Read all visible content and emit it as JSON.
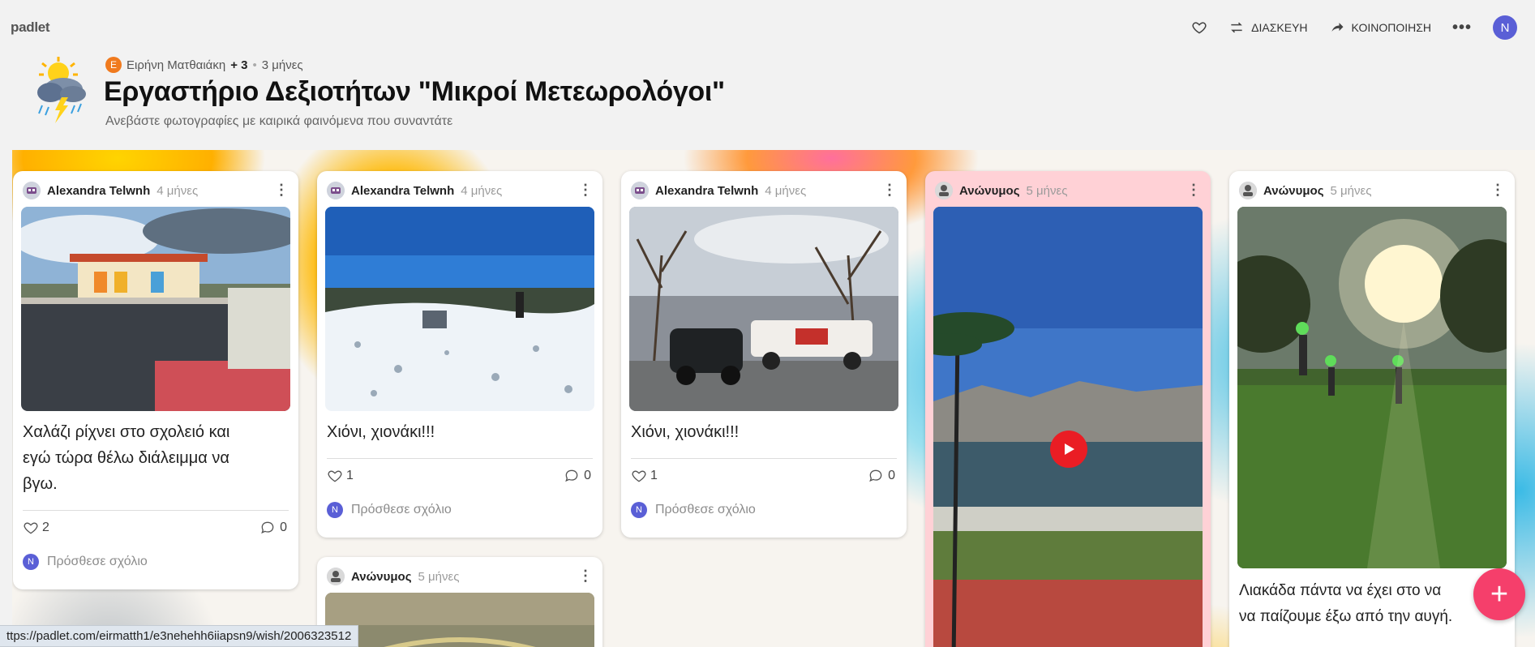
{
  "app": {
    "logo": "padlet"
  },
  "toolbar": {
    "like_icon": "heart-icon",
    "remix_label": "ΔΙΑΣΚΕΥΗ",
    "share_label": "ΚΟΙΝΟΠΟΙΗΣΗ",
    "more_label": "•••",
    "user_initial": "N"
  },
  "header": {
    "owner_initial": "Ε",
    "owner": "Ειρήνη Ματθαιάκη",
    "collaborators": "+ 3",
    "separator": "•",
    "age": "3 μήνες",
    "title": "Εργαστήριο Δεξιοτήτων \"Μικροί Μετεωρολόγοι\"",
    "subtitle": "Ανεβάστε φωτογραφίες με καιρικά φαινόμενα που συναντάτε"
  },
  "posts": [
    {
      "author": "Alexandra Telwnh",
      "time": "4 μήνες",
      "text_lines": [
        "Χαλάζι ρίχνει στο σχολειό και",
        "εγώ τώρα θέλω διάλειμμα να",
        "βγω."
      ],
      "likes": "2",
      "comments": "0",
      "add_comment": "Πρόσθεσε σχόλιο",
      "user_initial": "N"
    },
    {
      "author": "Alexandra Telwnh",
      "time": "4 μήνες",
      "text": "Χιόνι, χιονάκι!!!",
      "likes": "1",
      "comments": "0",
      "add_comment": "Πρόσθεσε σχόλιο",
      "user_initial": "N"
    },
    {
      "author": "Alexandra Telwnh",
      "time": "4 μήνες",
      "text": "Χιόνι, χιονάκι!!!",
      "likes": "1",
      "comments": "0",
      "add_comment": "Πρόσθεσε σχόλιο",
      "user_initial": "N"
    },
    {
      "author": "Ανώνυμος",
      "time": "5 μήνες"
    },
    {
      "author": "Ανώνυμος",
      "time": "5 μήνες",
      "text_lines": [
        "Λιακάδα πάντα να έχει στο να",
        "να παίζουμε έξω από την αυγή."
      ]
    },
    {
      "author": "Ανώνυμος",
      "time": "5 μήνες"
    }
  ],
  "fab_label": "+",
  "status_url": "ttps://padlet.com/eirmatth1/e3nehehh6iiapsn9/wish/2006323512"
}
